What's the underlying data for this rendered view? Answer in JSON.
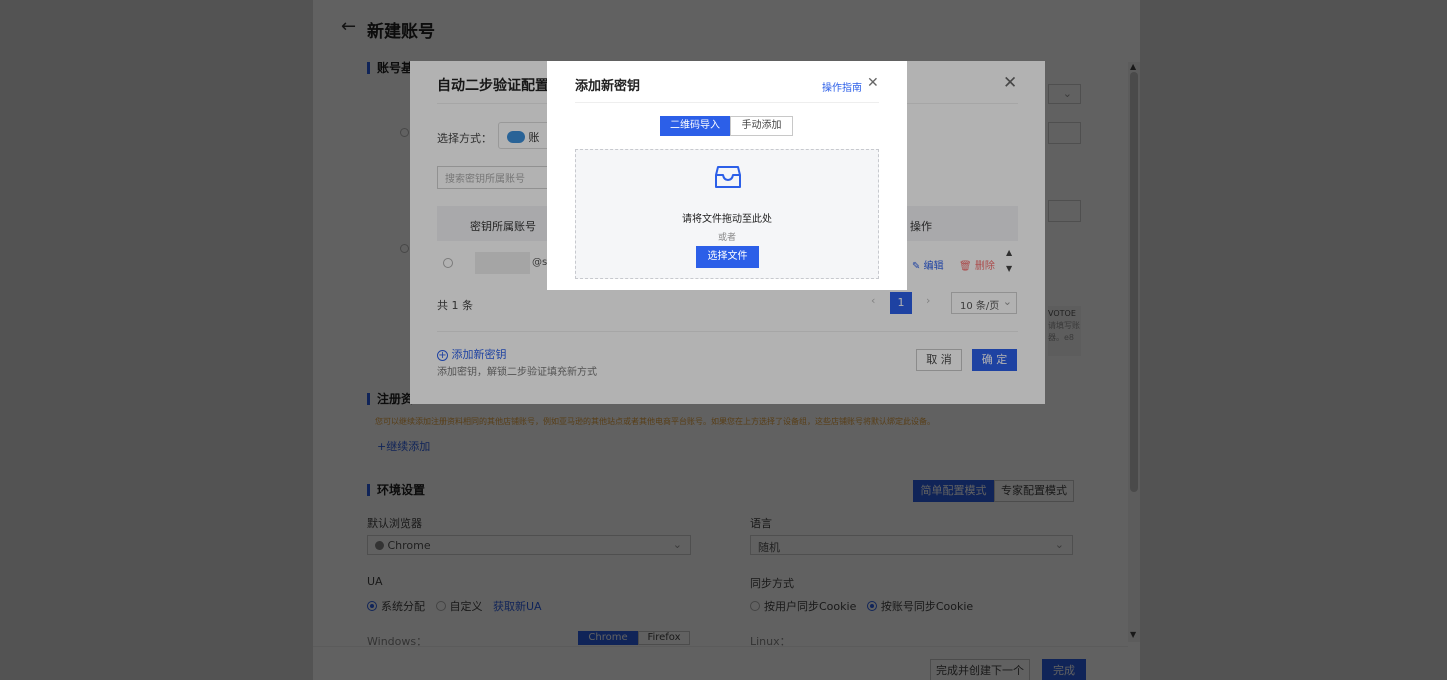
{
  "page": {
    "title": "新建账号",
    "sections": {
      "basic": "账号基",
      "register": "注册资",
      "env": "环境设置"
    },
    "register_notice": "您可以继续添加注册资料相同的其他店铺账号，例如亚马逊的其他站点或者其他电商平台账号。如果您在上方选择了设备组，这些店铺账号将默认绑定此设备。",
    "continue_add": "继续添加",
    "config_modes": [
      "简单配置模式",
      "专家配置模式"
    ],
    "browser_label": "默认浏览器",
    "browser_value": "Chrome",
    "language_label": "语言",
    "language_value": "随机",
    "ua_label": "UA",
    "ua_options": [
      "系统分配",
      "自定义"
    ],
    "get_ua": "获取新UA",
    "sync_label": "同步方式",
    "sync_options": [
      "按用户同步Cookie",
      "按账号同步Cookie"
    ],
    "windows_label": "Windows：",
    "linux_label": "Linux：",
    "os_tabs": [
      "Chrome",
      "Firefox"
    ],
    "side_texts": [
      "VOTOE",
      "请填写账",
      "器。e8"
    ],
    "footer": {
      "create_next": "完成并创建下一个",
      "finish": "完成"
    }
  },
  "dialog1": {
    "title": "自动二步验证配置",
    "method_label": "选择方式：",
    "method_value": "账",
    "search_placeholder": "搜索密钥所属账号",
    "columns": [
      "密钥所属账号",
      "操作"
    ],
    "row": {
      "account_suffix": "@si",
      "edit": "编辑",
      "delete": "删除"
    },
    "total": "共 1 条",
    "current_page": "1",
    "page_size": "10 条/页",
    "add_key": "添加新密钥",
    "add_key_desc": "添加密钥，解锁二步验证填充新方式",
    "cancel": "取 消",
    "ok": "确 定"
  },
  "dialog2": {
    "title": "添加新密钥",
    "guide": "操作指南",
    "tabs": [
      "二维码导入",
      "手动添加"
    ],
    "drop_text": "请将文件拖动至此处",
    "or_text": "或者",
    "choose_file": "选择文件"
  },
  "colors": {
    "primary": "#2c5fe8",
    "warning_text": "#e6a23c",
    "danger": "#f56c6c"
  }
}
